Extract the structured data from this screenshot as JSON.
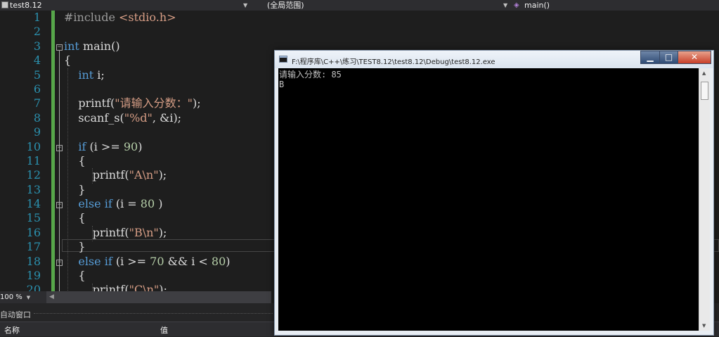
{
  "navbar": {
    "project": "test8.12",
    "project_icon": "project-icon",
    "scope": "(全局范围)",
    "function": "main()",
    "function_icon": "method-cube-icon",
    "dropdown_arrow": "▼"
  },
  "editor": {
    "line_numbers": [
      "1",
      "2",
      "3",
      "4",
      "5",
      "6",
      "7",
      "8",
      "9",
      "10",
      "11",
      "12",
      "13",
      "14",
      "15",
      "16",
      "17",
      "18",
      "19",
      "20"
    ],
    "code": {
      "l1_directive": "#include",
      "l1_header": " <stdio.h>",
      "l3_type": "int",
      "l3_rest": " main()",
      "l4": "{",
      "l5_type": "int",
      "l5_rest": " i;",
      "l7_fn": "printf(",
      "l7_str": "\"请输入分数：\"",
      "l7_end": ");",
      "l8_fn": "scanf_s(",
      "l8_str": "\"%d\"",
      "l8_end": ", &i);",
      "l10_kw": "if",
      "l10_a": " (i >= ",
      "l10_num": "90",
      "l10_b": ")",
      "l11": "{",
      "l12_fn": "printf(",
      "l12_str": "\"A\\n\"",
      "l12_end": ");",
      "l13": "}",
      "l14_kw": "else if",
      "l14_a": " (i = ",
      "l14_num": "80",
      "l14_b": " )",
      "l15": "{",
      "l16_fn": "printf(",
      "l16_str": "\"B\\n\"",
      "l16_end": ");",
      "l17": "}",
      "l18_kw": "else if",
      "l18_a": " (i >= ",
      "l18_num1": "70",
      "l18_b": " && i < ",
      "l18_num2": "80",
      "l18_c": ")",
      "l19": "{",
      "l20_fn": "printf(",
      "l20_str": "\"C\\n\"",
      "l20_end": ");"
    },
    "colors": {
      "keyword": "#569cd6",
      "string": "#d69d85",
      "number": "#b5cea8",
      "line_number": "#2b91af",
      "change_bar": "#57a64a"
    }
  },
  "zoom": {
    "value": "100 %",
    "arrow": "▼"
  },
  "autos_panel": {
    "title": "自动窗口",
    "col_name": "名称",
    "col_value": "值"
  },
  "console": {
    "title": "F:\\程序库\\C++\\练习\\TEST8.12\\test8.12\\Debug\\test8.12.exe",
    "minimize": "▁",
    "maximize": "□",
    "close": "✕",
    "output": [
      "请输入分数: 85",
      "B"
    ],
    "scroll_up": "▲",
    "scroll_down": "▼"
  }
}
